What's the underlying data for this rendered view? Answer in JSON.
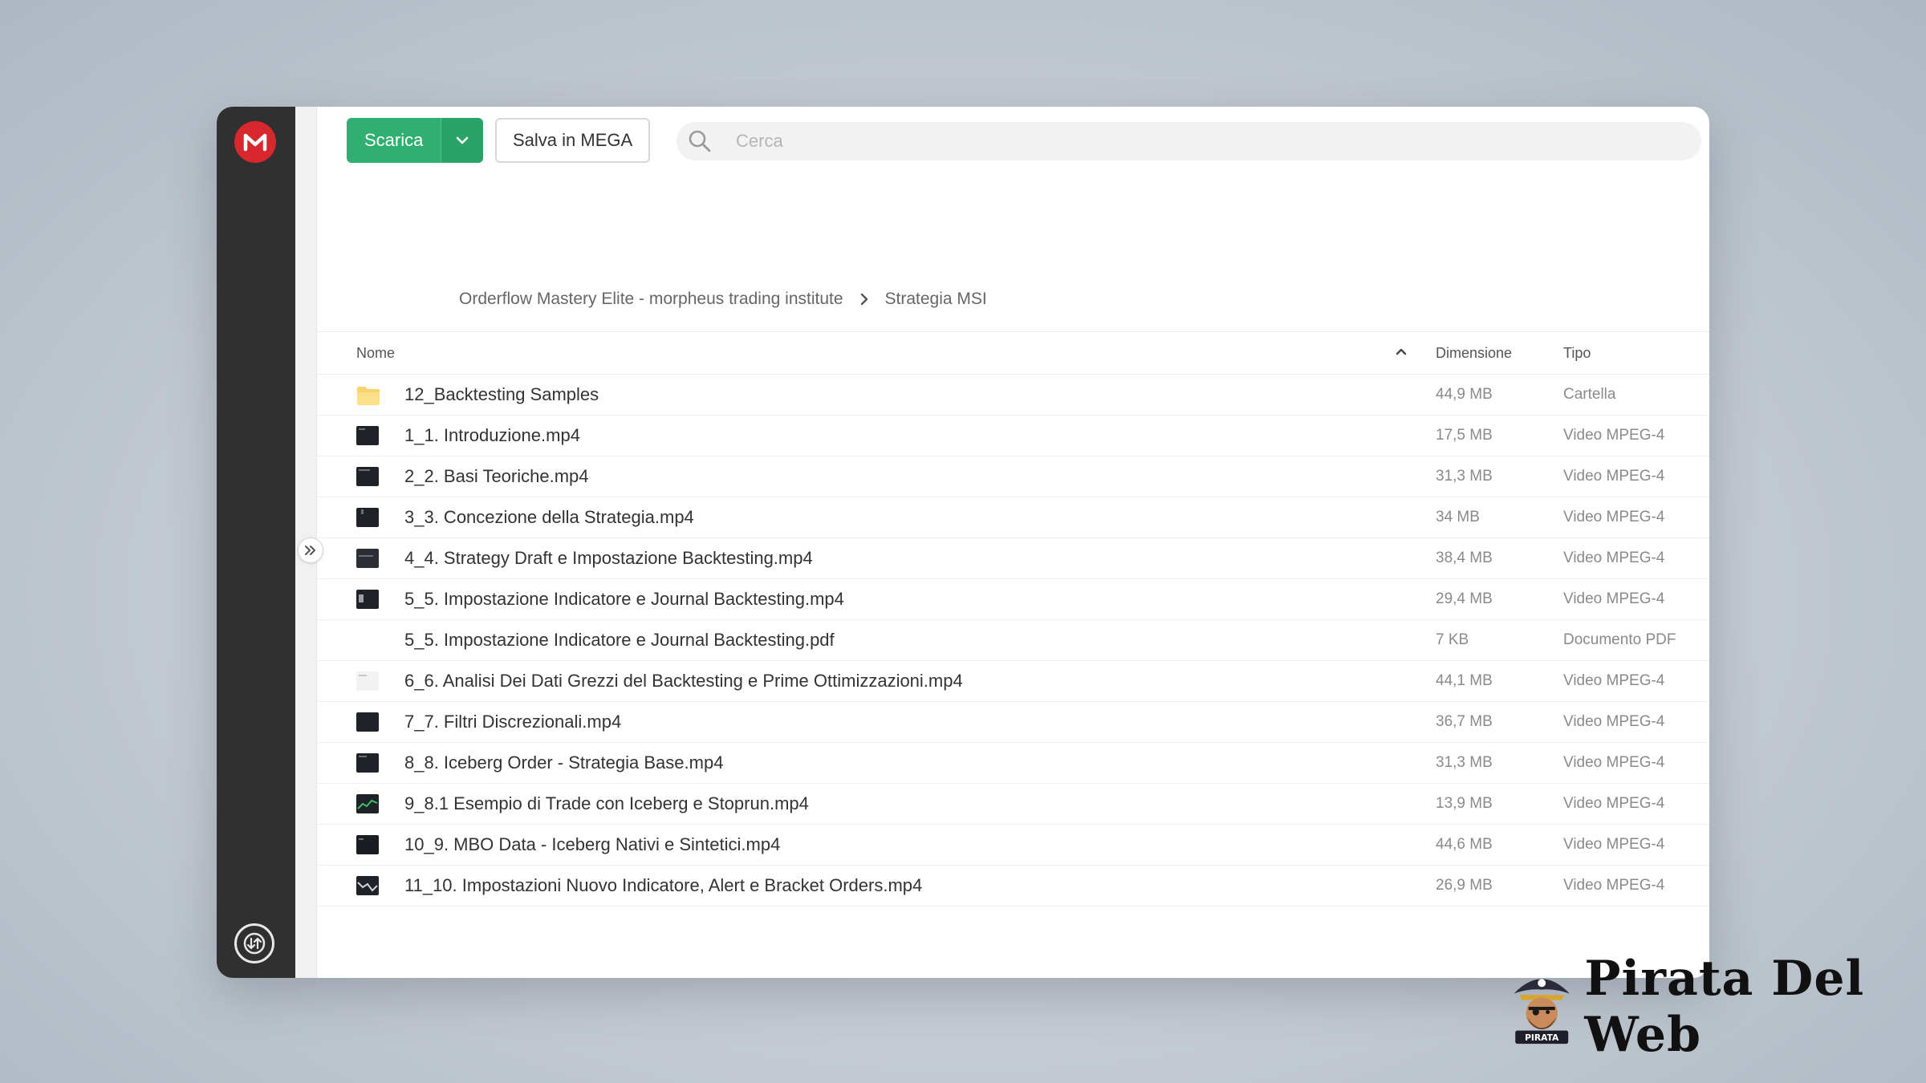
{
  "toolbar": {
    "download_label": "Scarica",
    "save_label": "Salva in MEGA",
    "search_placeholder": "Cerca"
  },
  "breadcrumb": {
    "items": [
      "Orderflow Mastery Elite - morpheus trading institute",
      "Strategia MSI"
    ]
  },
  "table": {
    "columns": {
      "name": "Nome",
      "size": "Dimensione",
      "type": "Tipo"
    },
    "rows": [
      {
        "name": "12_Backtesting Samples",
        "size": "44,9 MB",
        "type": "Cartella",
        "icon": "folder-icon"
      },
      {
        "name": "1_1. Introduzione.mp4",
        "size": "17,5 MB",
        "type": "Video MPEG-4",
        "icon": "video-thumbnail-icon"
      },
      {
        "name": "2_2. Basi Teoriche.mp4",
        "size": "31,3 MB",
        "type": "Video MPEG-4",
        "icon": "video-thumbnail-icon"
      },
      {
        "name": "3_3. Concezione della Strategia.mp4",
        "size": "34 MB",
        "type": "Video MPEG-4",
        "icon": "video-thumbnail-icon"
      },
      {
        "name": "4_4. Strategy Draft e Impostazione Backtesting.mp4",
        "size": "38,4 MB",
        "type": "Video MPEG-4",
        "icon": "video-thumbnail-icon"
      },
      {
        "name": "5_5. Impostazione Indicatore e Journal Backtesting.mp4",
        "size": "29,4 MB",
        "type": "Video MPEG-4",
        "icon": "video-thumbnail-icon"
      },
      {
        "name": "5_5. Impostazione Indicatore e Journal Backtesting.pdf",
        "size": "7 KB",
        "type": "Documento PDF",
        "icon": "pdf-icon"
      },
      {
        "name": "6_6. Analisi Dei Dati Grezzi del Backtesting e Prime Ottimizzazioni.mp4",
        "size": "44,1 MB",
        "type": "Video MPEG-4",
        "icon": "video-thumbnail-icon"
      },
      {
        "name": "7_7. Filtri Discrezionali.mp4",
        "size": "36,7 MB",
        "type": "Video MPEG-4",
        "icon": "video-thumbnail-icon"
      },
      {
        "name": "8_8. Iceberg Order - Strategia Base.mp4",
        "size": "31,3 MB",
        "type": "Video MPEG-4",
        "icon": "video-thumbnail-icon"
      },
      {
        "name": "9_8.1 Esempio di Trade con Iceberg e Stoprun.mp4",
        "size": "13,9 MB",
        "type": "Video MPEG-4",
        "icon": "video-thumbnail-icon"
      },
      {
        "name": "10_9. MBO Data - Iceberg Nativi e Sintetici.mp4",
        "size": "44,6 MB",
        "type": "Video MPEG-4",
        "icon": "video-thumbnail-icon"
      },
      {
        "name": "11_10. Impostazioni Nuovo Indicatore, Alert e Bracket Orders.mp4",
        "size": "26,9 MB",
        "type": "Video MPEG-4",
        "icon": "video-thumbnail-icon"
      }
    ]
  },
  "brand": {
    "name": "Pirata Del Web",
    "badge": "PIRATA"
  },
  "colors": {
    "mega_red": "#d9272e",
    "download_green": "#2fb070",
    "sidebar_dark": "#303030",
    "folder_yellow": "#f6d46b"
  }
}
